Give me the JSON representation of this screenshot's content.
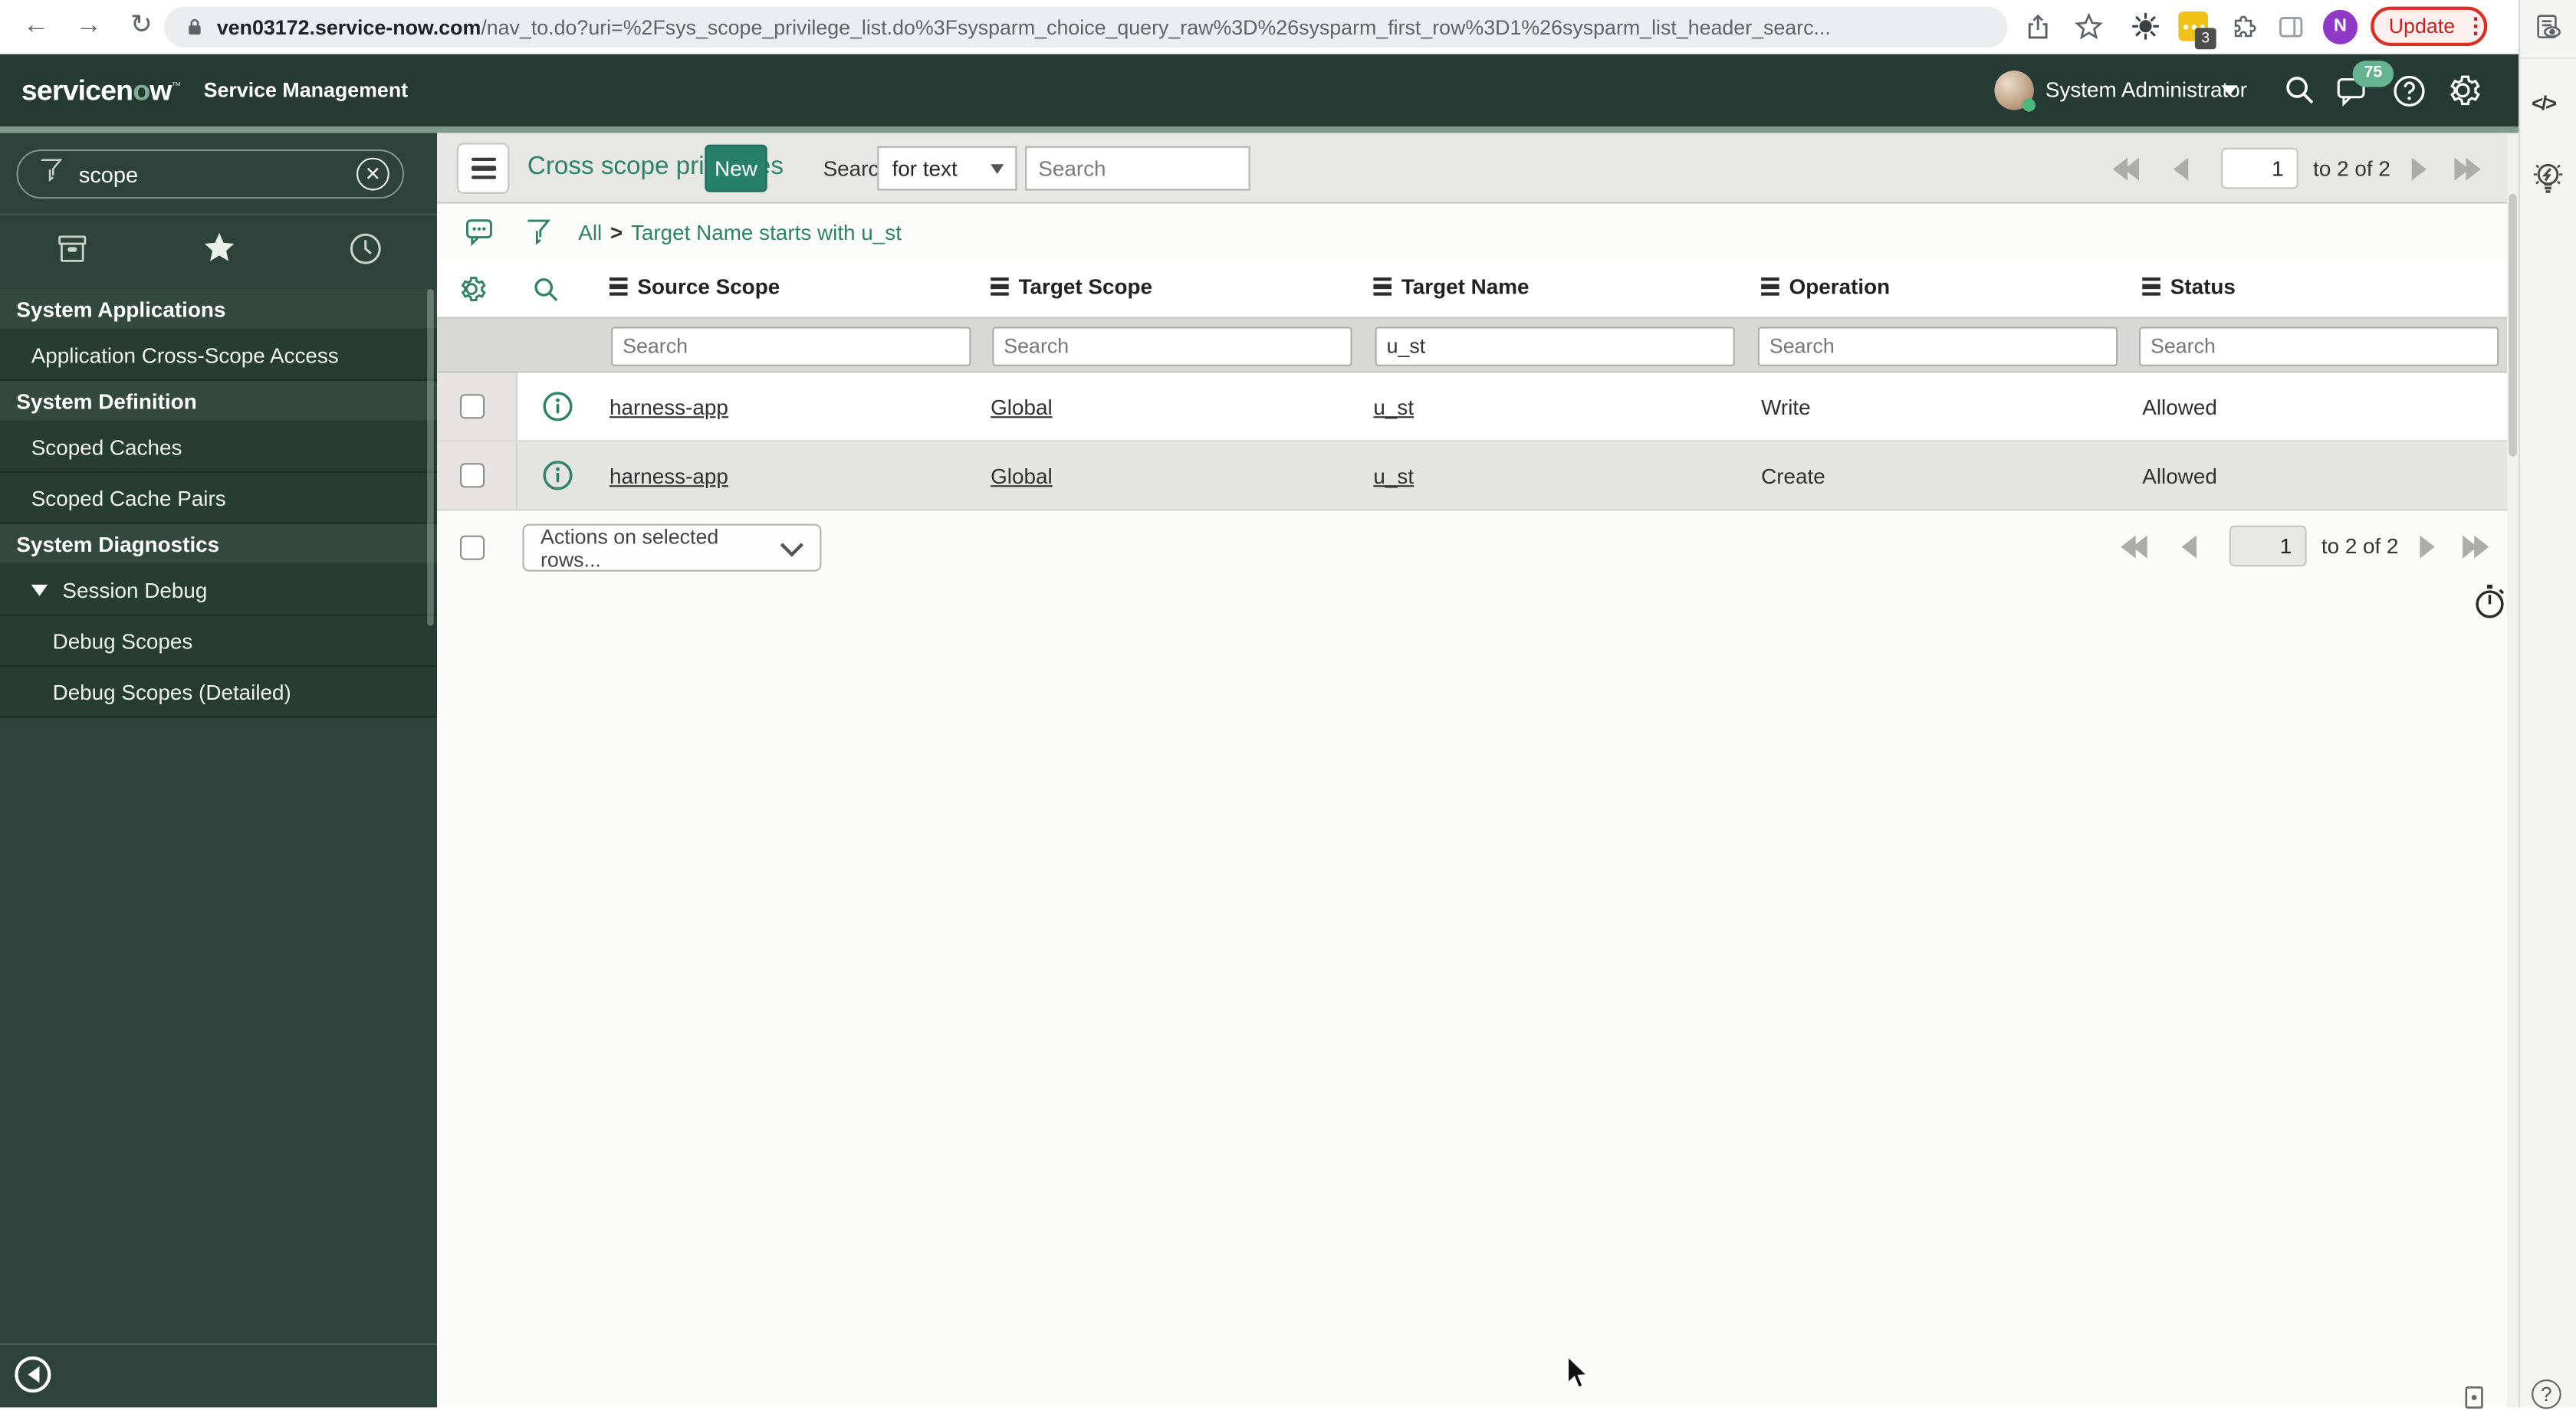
{
  "browser": {
    "url_domain": "ven03172.service-now.com",
    "url_path": "/nav_to.do?uri=%2Fsys_scope_privilege_list.do%3Fsysparm_choice_query_raw%3D%26sysparm_first_row%3D1%26sysparm_list_header_searc...",
    "update_button": "Update",
    "extension_badge": "3",
    "profile_initial": "N"
  },
  "app_header": {
    "logo_part1": "servicen",
    "logo_o": "o",
    "logo_part2": "w",
    "logo_tm": "™",
    "product_label": "Service Management",
    "user_name": "System Administrator",
    "notification_count": "75"
  },
  "sidebar": {
    "filter_value": "scope",
    "items": [
      {
        "label": "System Applications",
        "type": "header"
      },
      {
        "label": "Application Cross-Scope Access",
        "type": "item"
      },
      {
        "label": "System Definition",
        "type": "header"
      },
      {
        "label": "Scoped Caches",
        "type": "item"
      },
      {
        "label": "Scoped Cache Pairs",
        "type": "item"
      },
      {
        "label": "System Diagnostics",
        "type": "header"
      },
      {
        "label": "Session Debug",
        "type": "item-expanded"
      },
      {
        "label": "Debug Scopes",
        "type": "subitem"
      },
      {
        "label": "Debug Scopes (Detailed)",
        "type": "subitem"
      }
    ]
  },
  "list": {
    "title": "Cross scope privileges",
    "new_button": "New",
    "search_label": "Search",
    "search_type": "for text",
    "search_placeholder": "Search",
    "breadcrumb": {
      "root": "All",
      "separator": ">",
      "current": "Target Name starts with u_st"
    },
    "columns": [
      "Source Scope",
      "Target Scope",
      "Target Name",
      "Operation",
      "Status"
    ],
    "filter_row": {
      "placeholder": "Search",
      "target_name_value": "u_st"
    },
    "rows": [
      {
        "source_scope": "harness-app",
        "target_scope": "Global",
        "target_name": "u_st",
        "operation": "Write",
        "status": "Allowed"
      },
      {
        "source_scope": "harness-app",
        "target_scope": "Global",
        "target_name": "u_st",
        "operation": "Create",
        "status": "Allowed"
      }
    ],
    "actions_select": "Actions on selected rows...",
    "pagination": {
      "page": "1",
      "range": "to 2 of 2"
    }
  },
  "rail": {
    "code_glyph": "</>",
    "help_glyph": "?"
  },
  "colors": {
    "accent_teal": "#278069",
    "link_teal": "#2f8268",
    "header_bg": "#253a32",
    "sidebar_bg": "#2c423a",
    "sidebar_section_bg": "#33493f",
    "strip_sage": "#7f9b8b",
    "badge_green": "#66b392",
    "update_red": "#c5221f",
    "profile_purple": "#9038c8",
    "extension_yellow": "#f0c116",
    "row_zebra": "#e4e4e2"
  }
}
